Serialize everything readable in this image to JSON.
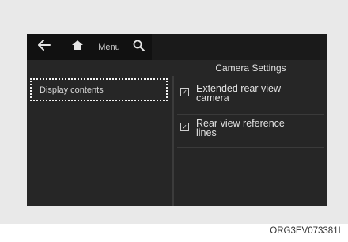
{
  "toolbar": {
    "back_icon": "back-arrow-icon",
    "home_icon": "home-icon",
    "menu_label": "Menu",
    "search_icon": "search-icon"
  },
  "panel": {
    "title": "Camera Settings"
  },
  "sidebar": {
    "items": [
      {
        "label": "Display contents",
        "selected": true
      }
    ]
  },
  "options": [
    {
      "label_line1": "Extended rear view",
      "label_line2": "camera",
      "checked": true
    },
    {
      "label_line1": "Rear view reference",
      "label_line2": "lines",
      "checked": true
    }
  ],
  "caption": "ORG3EV073381L",
  "colors": {
    "screen_bg": "#262626",
    "topbar_bg": "#111111",
    "text": "#e2e2e2",
    "frame_bg": "#e9e9e9"
  }
}
